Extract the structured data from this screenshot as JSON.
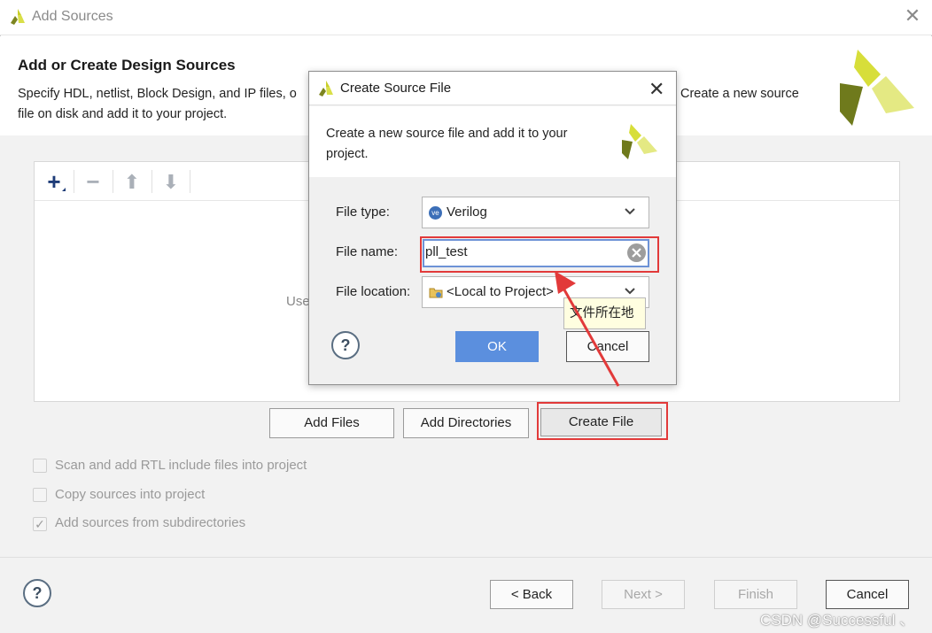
{
  "window": {
    "title": "Add Sources",
    "close_glyph": "✕"
  },
  "header": {
    "title": "Add or Create Design Sources",
    "desc_line1": "Specify HDL, netlist, Block Design, and IP files, o",
    "desc_line2": "file on disk and add it to your project.",
    "desc_right": "Create a new source"
  },
  "toolbar": {
    "add_glyph": "+",
    "remove_glyph": "−",
    "up_glyph": "⬆",
    "down_glyph": "⬇"
  },
  "panel": {
    "hint_fragment": "Use"
  },
  "buttons": {
    "add_files": "Add Files",
    "add_directories": "Add Directories",
    "create_file": "Create File"
  },
  "options": [
    {
      "label": "Scan and add RTL include files into project",
      "checked": false
    },
    {
      "label": "Copy sources into project",
      "checked": false
    },
    {
      "label": "Add sources from subdirectories",
      "checked": true
    }
  ],
  "footer": {
    "help": "?",
    "back": "< Back",
    "next": "Next >",
    "finish": "Finish",
    "cancel": "Cancel"
  },
  "dialog": {
    "title": "Create Source File",
    "close_glyph": "✕",
    "desc_line1": "Create a new source file and add it to your",
    "desc_line2": "project.",
    "file_type_label": "File type:",
    "file_type_value": "Verilog",
    "file_type_icon_text": "ve",
    "file_name_label": "File name:",
    "file_name_value": "pll_test",
    "file_location_label": "File location:",
    "file_location_value": "<Local to Project>",
    "help": "?",
    "ok": "OK",
    "cancel": "Cancel",
    "tooltip": "文件所在地"
  },
  "watermark": "CSDN @Successful 、",
  "colors": {
    "accent_blue": "#5b8fde",
    "highlight_red": "#e23a3a",
    "logo_yellow": "#d4dc3c",
    "logo_dark": "#6f7a1c"
  }
}
